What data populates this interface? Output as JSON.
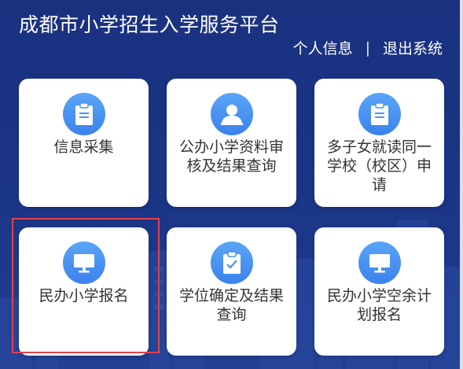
{
  "header": {
    "title": "成都市小学招生入学服务平台",
    "personal_info_label": "个人信息",
    "separator": "|",
    "logout_label": "退出系统"
  },
  "cards": [
    {
      "label": "信息采集",
      "icon": "clipboard-icon"
    },
    {
      "label": "公办小学资料审核及结果查询",
      "icon": "user-profile-icon"
    },
    {
      "label": "多子女就读同一学校（校区）申请",
      "icon": "clipboard-icon"
    },
    {
      "label": "民办小学报名",
      "icon": "monitor-icon"
    },
    {
      "label": "学位确定及结果查询",
      "icon": "clipboard-check-icon"
    },
    {
      "label": "民办小学空余计划报名",
      "icon": "monitor-icon"
    }
  ],
  "colors": {
    "background": "#1b3587",
    "icon_accent": "#3b82ee",
    "highlight": "#e0424c"
  }
}
